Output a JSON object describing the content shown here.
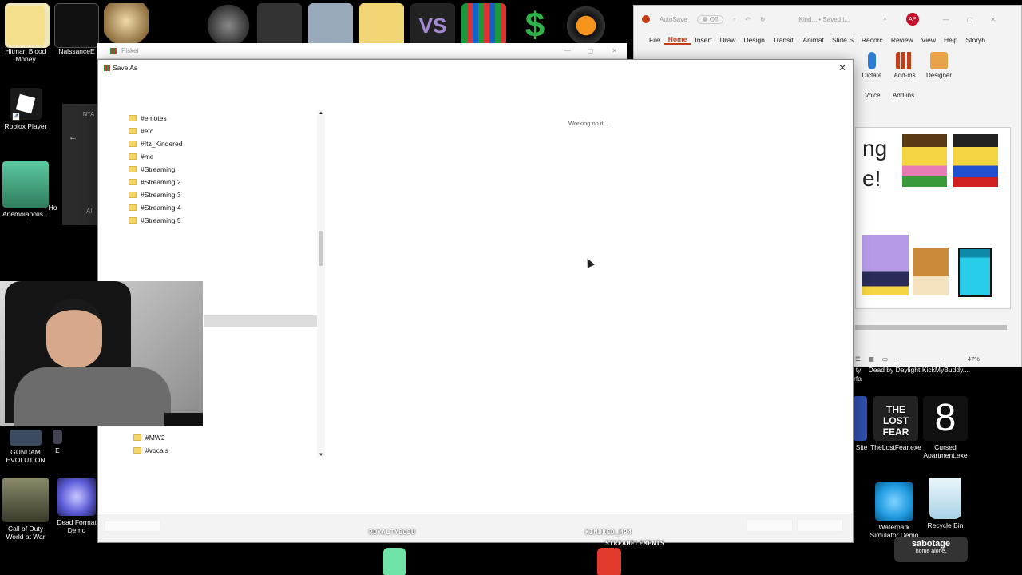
{
  "desktop": {
    "icons_left": [
      {
        "label": "Hitman Blood Money",
        "color": "#f4e08a"
      },
      {
        "label": "NaissanceE",
        "color": "#111111"
      },
      {
        "label": "Roblox Player",
        "color": "#1a1a1a"
      },
      {
        "label": "Anemoiapolis...",
        "color": "#3aa37a"
      },
      {
        "label": "GUNDAM EVOLUTION",
        "color": "#3d4b61"
      },
      {
        "label": "Call of Duty World at War",
        "color": "#6a6a52"
      },
      {
        "label": "Dead Format Demo",
        "color": "#5b5bd9"
      }
    ],
    "icons_right": [
      {
        "label": "Dead by Daylight",
        "color": "#2a2a2a"
      },
      {
        "label": "KickMyBuddy....",
        "color": "#2a2a2a"
      },
      {
        "label": "Site",
        "color": "#2a2a2a"
      },
      {
        "label": "TheLostFear.exe",
        "color": "#222222"
      },
      {
        "label": "Cursed Apartment.exe",
        "color": "#111111"
      },
      {
        "label": "Waterpark Simulator Demo",
        "color": "#1f9adf"
      },
      {
        "label": "Recycle Bin",
        "color": "#cfe9f5"
      }
    ],
    "partial_labels": {
      "hc": "Ho",
      "e": "E",
      "nya": "NYA",
      "ai": "AI",
      "ty": "ty",
      "rfa": "rfa"
    },
    "right_tile_text": {
      "lost_fear": "THE LOST FEAR",
      "cursed_number": "8"
    }
  },
  "piskel_window": {
    "title": "Piskel"
  },
  "save_dialog": {
    "title": "Save As",
    "working_text": "Working on it...",
    "folders_top": [
      "#emotes",
      "#etc",
      "#Itz_Kindered",
      "#me",
      "#Streaming",
      "#Streaming 2",
      "#Streaming 3",
      "#Streaming 4",
      "#Streaming 5"
    ],
    "folders_bottom": [
      "#MW2",
      "#vocals"
    ]
  },
  "powerpoint": {
    "autosave": "AutoSave",
    "toggle": "Off",
    "doc_title": "Kind... • Saved t...",
    "avatar": "AP",
    "tabs": [
      "File",
      "Home",
      "Insert",
      "Draw",
      "Design",
      "Transiti",
      "Animat",
      "Slide S",
      "Recorc",
      "Review",
      "View",
      "Help",
      "Storyb"
    ],
    "active_tab": "Home",
    "ribbon": [
      {
        "label": "Dictate",
        "group": "Voice"
      },
      {
        "label": "Add-ins",
        "group": "Add-ins"
      },
      {
        "label": "Designer",
        "group": ""
      }
    ],
    "slide_text_line1": "ng",
    "slide_text_line2": "e!",
    "zoom": "47%"
  },
  "stream_overlay": {
    "left_name": "ROYALTYBOJU",
    "right_name": "KINDRED_MP4",
    "streamelements": "STREAMELEMENTS",
    "sabotage_title": "sabotage",
    "sabotage_sub": "home alone."
  },
  "colors": {
    "ppt_accent": "#c43e1c",
    "folder": "#f5d66b",
    "dialog_bg": "#ffffff"
  }
}
